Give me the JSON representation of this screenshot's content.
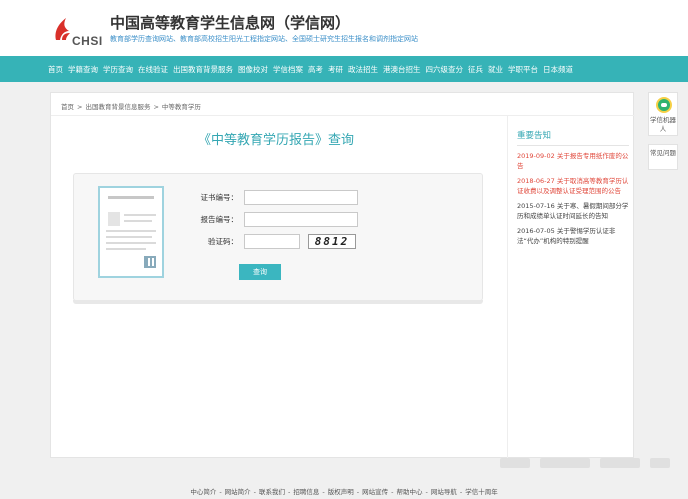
{
  "header": {
    "logo_text": "CHSI",
    "site_title": "中国高等教育学生信息网（学信网）",
    "site_subtitle": "教育部学历查询网站、教育部高校招生阳光工程指定网站、全国硕士研究生招生报名和调剂指定网站",
    "brand_color": "#d9302a"
  },
  "nav": {
    "items": [
      "首页",
      "学籍查询",
      "学历查询",
      "在线验证",
      "出国教育背景服务",
      "图像校对",
      "学信档案",
      "高考",
      "考研",
      "政法招生",
      "港澳台招生",
      "四六级查分",
      "征兵",
      "就业",
      "学职平台",
      "日本频道"
    ],
    "bg_color": "#36b3b7"
  },
  "breadcrumb": {
    "items": [
      "首页",
      "出国教育背景信息服务",
      "中等教育学历"
    ],
    "separator": ">"
  },
  "query": {
    "title": "《中等教育学历报告》查询",
    "cert_no_label": "证书编号：",
    "report_no_label": "报告编号：",
    "captcha_label": "验证码：",
    "cert_no_value": "",
    "report_no_value": "",
    "captcha_value": "",
    "captcha_text": "8812",
    "submit_label": "查询"
  },
  "notice": {
    "title": "重要告知",
    "items": [
      {
        "text": "2019-09-02 关于报告专用纸作废的公告",
        "style": "red"
      },
      {
        "text": "2018-06-27 关于取消高等教育学历认证收费以及调整认证受理范围的公告",
        "style": "red"
      },
      {
        "text": "2015-07-16 关于寒、暑假期间部分学历和成绩单认证时间延长的告知",
        "style": "gray"
      },
      {
        "text": "2016-07-05 关于警惕学历认证非法“代办”机构的特别提醒",
        "style": "gray"
      }
    ]
  },
  "float_panel": {
    "robot_label": "学信机器人",
    "faq_label": "常见问题"
  },
  "footer": {
    "links": [
      "中心简介",
      "网站简介",
      "联系我们",
      "招聘信息",
      "版权声明",
      "网站宣传",
      "帮助中心",
      "网站导航",
      "学信十周年"
    ],
    "separator": "-"
  }
}
